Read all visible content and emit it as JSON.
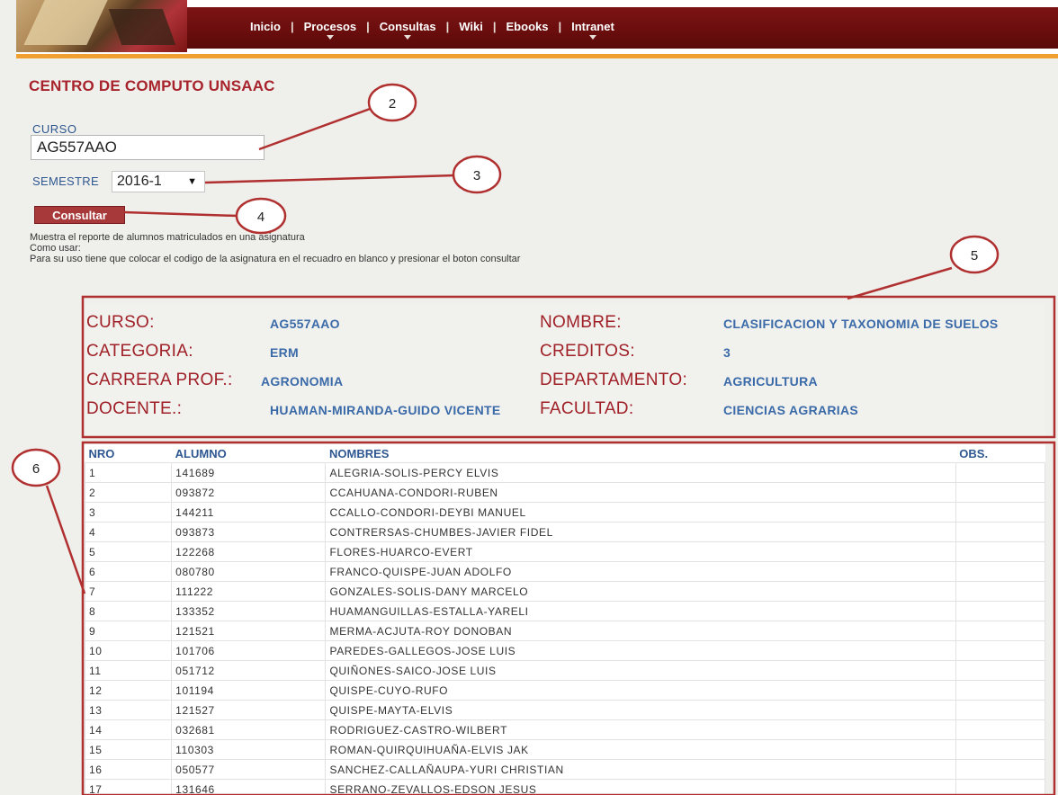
{
  "nav": {
    "items": [
      {
        "label": "Inicio",
        "has_menu": false
      },
      {
        "label": "Procesos",
        "has_menu": true
      },
      {
        "label": "Consultas",
        "has_menu": true
      },
      {
        "label": "Wiki",
        "has_menu": false
      },
      {
        "label": "Ebooks",
        "has_menu": false
      },
      {
        "label": "Intranet",
        "has_menu": true
      }
    ],
    "separator": "|"
  },
  "header": {
    "title": "CENTRO DE COMPUTO UNSAAC"
  },
  "form": {
    "curso_label": "CURSO",
    "curso_value": "AG557AAO",
    "semestre_label": "SEMESTRE",
    "semestre_value": "2016-1",
    "submit_label": "Consultar"
  },
  "help": {
    "line1": "Muestra el reporte de alumnos matriculados en una asignatura",
    "line2": "Como usar:",
    "line3": "Para su uso tiene que colocar el codigo de la asignatura en el recuadro en blanco y presionar el boton consultar"
  },
  "course_info": {
    "curso_label": "CURSO:",
    "curso_value": "AG557AAO",
    "nombre_label": "NOMBRE:",
    "nombre_value": "CLASIFICACION Y TAXONOMIA DE SUELOS",
    "categoria_label": "CATEGORIA:",
    "categoria_value": "ERM",
    "creditos_label": "CREDITOS:",
    "creditos_value": "3",
    "carrera_label": "CARRERA PROF.:",
    "carrera_value": "AGRONOMIA",
    "departamento_label": "DEPARTAMENTO:",
    "departamento_value": "AGRICULTURA",
    "docente_label": "DOCENTE.:",
    "docente_value": "HUAMAN-MIRANDA-GUIDO VICENTE",
    "facultad_label": "FACULTAD:",
    "facultad_value": "CIENCIAS AGRARIAS"
  },
  "table": {
    "headers": [
      "NRO",
      "ALUMNO",
      "NOMBRES",
      "OBS."
    ],
    "rows": [
      [
        "1",
        "141689",
        "ALEGRIA-SOLIS-PERCY ELVIS",
        ""
      ],
      [
        "2",
        "093872",
        "CCAHUANA-CONDORI-RUBEN",
        ""
      ],
      [
        "3",
        "144211",
        "CCALLO-CONDORI-DEYBI MANUEL",
        ""
      ],
      [
        "4",
        "093873",
        "CONTRERSAS-CHUMBES-JAVIER FIDEL",
        ""
      ],
      [
        "5",
        "122268",
        "FLORES-HUARCO-EVERT",
        ""
      ],
      [
        "6",
        "080780",
        "FRANCO-QUISPE-JUAN ADOLFO",
        ""
      ],
      [
        "7",
        "111222",
        "GONZALES-SOLIS-DANY MARCELO",
        ""
      ],
      [
        "8",
        "133352",
        "HUAMANGUILLAS-ESTALLA-YARELI",
        ""
      ],
      [
        "9",
        "121521",
        "MERMA-ACJUTA-ROY DONOBAN",
        ""
      ],
      [
        "10",
        "101706",
        "PAREDES-GALLEGOS-JOSE LUIS",
        ""
      ],
      [
        "11",
        "051712",
        "QUIÑONES-SAICO-JOSE LUIS",
        ""
      ],
      [
        "12",
        "101194",
        "QUISPE-CUYO-RUFO",
        ""
      ],
      [
        "13",
        "121527",
        "QUISPE-MAYTA-ELVIS",
        ""
      ],
      [
        "14",
        "032681",
        "RODRIGUEZ-CASTRO-WILBERT",
        ""
      ],
      [
        "15",
        "110303",
        "ROMAN-QUIRQUIHUAÑA-ELVIS JAK",
        ""
      ],
      [
        "16",
        "050577",
        "SANCHEZ-CALLAÑAUPA-YURI CHRISTIAN",
        ""
      ],
      [
        "17",
        "131646",
        "SERRANO-ZEVALLOS-EDSON JESUS",
        ""
      ]
    ]
  },
  "annotations": [
    "2",
    "3",
    "4",
    "5",
    "6"
  ],
  "colors": {
    "nav_bg": "#6a0d0d",
    "nav_accent": "#f0a030",
    "title_red": "#a8242c",
    "label_blue": "#2e5790",
    "button_bg": "#a8393a",
    "annotation_red": "#b03030"
  }
}
